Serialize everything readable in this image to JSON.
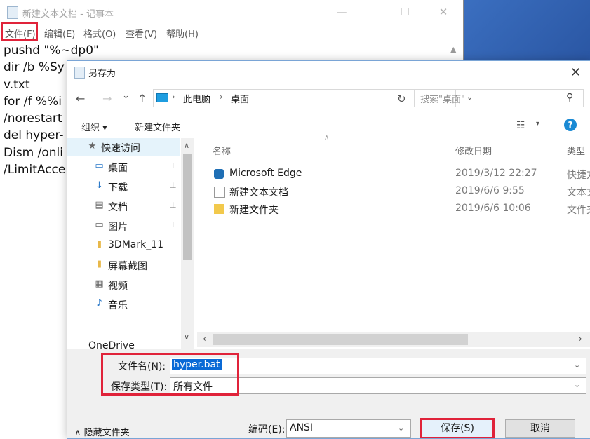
{
  "notepad": {
    "title": "新建文本文档 - 记事本",
    "window_controls": {
      "minimize": "—",
      "maximize": "☐",
      "close": "✕"
    },
    "menu": [
      "文件(F)",
      "编辑(E)",
      "格式(O)",
      "查看(V)",
      "帮助(H)"
    ],
    "text_lines": [
      "pushd \"%~dp0\"",
      "dir /b %Sy",
      "v.txt",
      "for /f %%i",
      "/norestart",
      "del hyper-",
      "Dism /onli",
      "/LimitAcce"
    ]
  },
  "dialog": {
    "title": "另存为",
    "close": "✕",
    "nav": {
      "back": "←",
      "forward": "→",
      "recent": "⌄",
      "up": "↑"
    },
    "address": {
      "crumbs": [
        "此电脑",
        "桌面"
      ],
      "sep": "›"
    },
    "refresh": "↻",
    "search_placeholder": "搜索\"桌面\"",
    "toolbar": {
      "organize": "组织 ▾",
      "new_folder": "新建文件夹",
      "view": "☷",
      "view_dd": "▾",
      "help": "?"
    },
    "nav_items": [
      {
        "label": "快速访问",
        "icon": "★",
        "icon_name": "star-icon",
        "pinned": false
      },
      {
        "label": "桌面",
        "icon": "▭",
        "icon_name": "desktop-icon",
        "pinned": true
      },
      {
        "label": "下载",
        "icon": "↓",
        "icon_name": "download-icon",
        "pinned": true
      },
      {
        "label": "文档",
        "icon": "▤",
        "icon_name": "document-icon",
        "pinned": true
      },
      {
        "label": "图片",
        "icon": "▭",
        "icon_name": "picture-icon",
        "pinned": true
      },
      {
        "label": "3DMark_11",
        "icon": "▮",
        "icon_name": "folder-icon",
        "pinned": false
      },
      {
        "label": "屏幕截图",
        "icon": "▮",
        "icon_name": "folder-icon",
        "pinned": false
      },
      {
        "label": "视频",
        "icon": "▦",
        "icon_name": "video-icon",
        "pinned": false
      },
      {
        "label": "音乐",
        "icon": "♪",
        "icon_name": "music-icon",
        "pinned": false
      }
    ],
    "onedrive": "OneDrive",
    "columns": {
      "name": "名称",
      "date": "修改日期",
      "type": "类型"
    },
    "files": [
      {
        "name": "Microsoft Edge",
        "date": "2019/3/12 22:27",
        "type": "快捷方",
        "icon_name": "edge-icon",
        "icon_color": "#1f6fb5"
      },
      {
        "name": "新建文本文档",
        "date": "2019/6/6 9:55",
        "type": "文本文",
        "icon_name": "text-file-icon",
        "icon_color": "#ffffff"
      },
      {
        "name": "新建文件夹",
        "date": "2019/6/6 10:06",
        "type": "文件夹",
        "icon_name": "folder-icon",
        "icon_color": "#f2c94c"
      }
    ],
    "filename_label": "文件名(N):",
    "filename_value": "hyper.bat",
    "filetype_label": "保存类型(T):",
    "filetype_value": "所有文件",
    "hide_folders": "∧ 隐藏文件夹",
    "encoding_label": "编码(E):",
    "encoding_value": "ANSI",
    "save_button": "保存(S)",
    "cancel_button": "取消"
  },
  "colors": {
    "highlight": "#e0233a",
    "selection": "#0a6ad6",
    "accent": "#0078d7"
  }
}
